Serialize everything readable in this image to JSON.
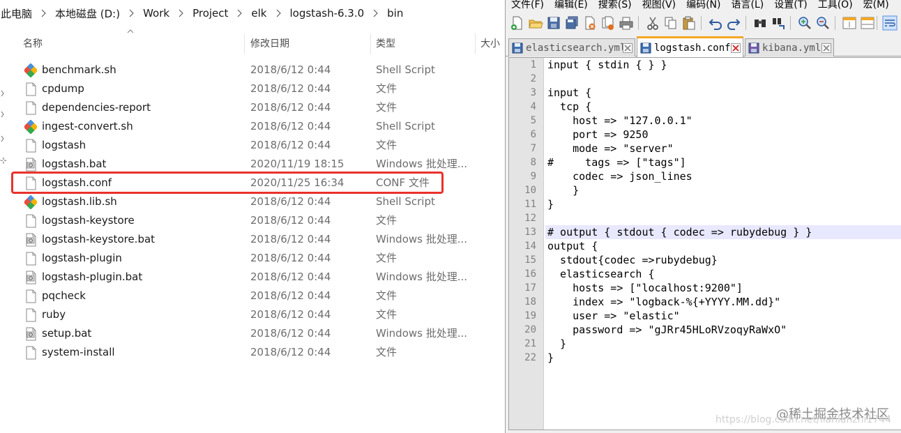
{
  "explorer": {
    "breadcrumb": [
      "此电脑",
      "本地磁盘 (D:)",
      "Work",
      "Project",
      "elk",
      "logstash-6.3.0",
      "bin"
    ],
    "columns": {
      "name": "名称",
      "modified": "修改日期",
      "type": "类型",
      "size": "大小"
    },
    "files": [
      {
        "name": "benchmark.sh",
        "modified": "2018/6/12 0:44",
        "type": "Shell Script",
        "icon": "shell-script-icon"
      },
      {
        "name": "cpdump",
        "modified": "2018/6/12 0:44",
        "type": "文件",
        "icon": "file-icon"
      },
      {
        "name": "dependencies-report",
        "modified": "2018/6/12 0:44",
        "type": "文件",
        "icon": "file-icon"
      },
      {
        "name": "ingest-convert.sh",
        "modified": "2018/6/12 0:44",
        "type": "Shell Script",
        "icon": "shell-script-icon"
      },
      {
        "name": "logstash",
        "modified": "2018/6/12 0:44",
        "type": "文件",
        "icon": "file-icon"
      },
      {
        "name": "logstash.bat",
        "modified": "2020/11/19 18:15",
        "type": "Windows 批处理...",
        "icon": "batch-file-icon"
      },
      {
        "name": "logstash.conf",
        "modified": "2020/11/25 16:34",
        "type": "CONF 文件",
        "icon": "file-icon"
      },
      {
        "name": "logstash.lib.sh",
        "modified": "2018/6/12 0:44",
        "type": "Shell Script",
        "icon": "shell-script-icon"
      },
      {
        "name": "logstash-keystore",
        "modified": "2018/6/12 0:44",
        "type": "文件",
        "icon": "file-icon"
      },
      {
        "name": "logstash-keystore.bat",
        "modified": "2018/6/12 0:44",
        "type": "Windows 批处理...",
        "icon": "batch-file-icon"
      },
      {
        "name": "logstash-plugin",
        "modified": "2018/6/12 0:44",
        "type": "文件",
        "icon": "file-icon"
      },
      {
        "name": "logstash-plugin.bat",
        "modified": "2018/6/12 0:44",
        "type": "Windows 批处理...",
        "icon": "batch-file-icon"
      },
      {
        "name": "pqcheck",
        "modified": "2018/6/12 0:44",
        "type": "文件",
        "icon": "file-icon"
      },
      {
        "name": "ruby",
        "modified": "2018/6/12 0:44",
        "type": "文件",
        "icon": "file-icon"
      },
      {
        "name": "setup.bat",
        "modified": "2018/6/12 0:44",
        "type": "Windows 批处理...",
        "icon": "batch-file-icon"
      },
      {
        "name": "system-install",
        "modified": "2018/6/12 0:44",
        "type": "文件",
        "icon": "file-icon"
      }
    ],
    "highlighted_file": "logstash.conf",
    "highlight_color": "#e8322b"
  },
  "notepad": {
    "menus": [
      "文件(F)",
      "编辑(E)",
      "搜索(S)",
      "视图(V)",
      "编码(N)",
      "语言(L)",
      "设置(T)",
      "工具(O)",
      "宏(M)"
    ],
    "toolbar_icons": [
      "new-file-icon",
      "open-file-icon",
      "save-icon",
      "save-all-icon",
      "close-icon",
      "close-all-icon",
      "print-icon",
      "cut-icon",
      "copy-icon",
      "paste-icon",
      "undo-icon",
      "redo-icon",
      "find-icon",
      "replace-icon",
      "zoom-in-icon",
      "zoom-out-icon",
      "sync-vertical-icon",
      "sync-horizontal-icon",
      "word-wrap-icon"
    ],
    "tabs": [
      {
        "label": "elasticsearch.yml",
        "active": false
      },
      {
        "label": "logstash.conf",
        "active": true
      },
      {
        "label": "kibana.yml",
        "active": false
      }
    ],
    "current_line": 13,
    "active_tab_accent": "#f5a623",
    "lines": [
      "input { stdin { } }",
      "",
      "input {",
      "  tcp {",
      "    host => \"127.0.0.1\"",
      "    port => 9250",
      "    mode => \"server\"",
      "#     tags => [\"tags\"]",
      "    codec => json_lines",
      "    }",
      "}",
      "",
      "# output { stdout { codec => rubydebug } }",
      "output {",
      "  stdout{codec =>rubydebug}",
      "  elasticsearch {",
      "    hosts => [\"localhost:9200\"]",
      "    index => \"logback-%{+YYYY.MM.dd}\"",
      "    user => \"elastic\"",
      "    password => \"gJRr45HLoRVzoqyRaWxO\"",
      "  }",
      "}"
    ]
  },
  "watermark": {
    "text": "@稀土掘金技术社区",
    "url": "https://blog.csdn.net/lianlanzhi1744"
  }
}
